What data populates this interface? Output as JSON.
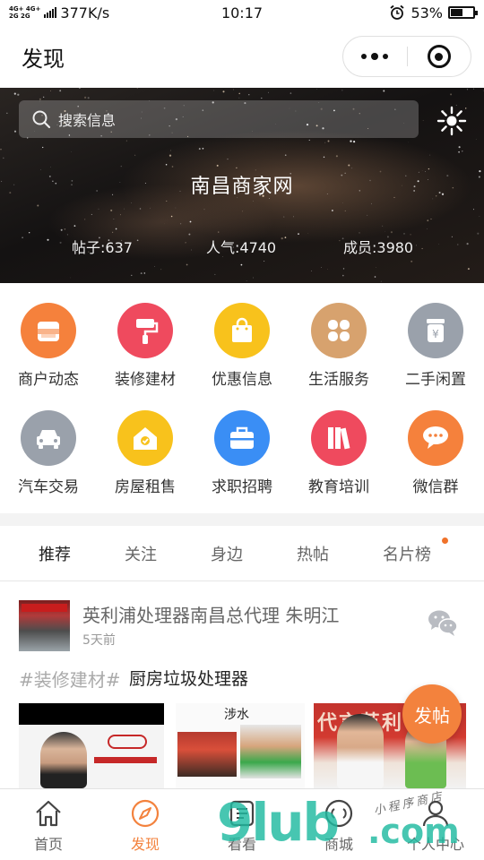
{
  "status_bar": {
    "network_top": "4G+ 4G+",
    "network_bottom": "2G 2G",
    "speed": "377K/s",
    "time": "10:17",
    "battery": "53%",
    "battery_level": 0.53,
    "icons": [
      "signal-icon",
      "alarm-icon",
      "battery-icon"
    ]
  },
  "nav": {
    "title": "发现",
    "capsule_icons": [
      "more-icon",
      "close-miniprogram-icon"
    ]
  },
  "banner": {
    "search_placeholder": "搜索信息",
    "site_name": "南昌商家网",
    "stats": [
      "帖子:637",
      "人气:4740",
      "成员:3980"
    ]
  },
  "categories": [
    {
      "label": "商户动态",
      "icon": "shop-icon",
      "color": "#f5813c"
    },
    {
      "label": "装修建材",
      "icon": "paint-roller-icon",
      "color": "#ef4a5e"
    },
    {
      "label": "优惠信息",
      "icon": "shopping-bag-icon",
      "color": "#f8c21c"
    },
    {
      "label": "生活服务",
      "icon": "clover-icon",
      "color": "#d7a26e"
    },
    {
      "label": "二手闲置",
      "icon": "yuan-jar-icon",
      "color": "#9aa1ab"
    },
    {
      "label": "汽车交易",
      "icon": "car-icon",
      "color": "#9aa1ab"
    },
    {
      "label": "房屋租售",
      "icon": "house-icon",
      "color": "#f8c21c"
    },
    {
      "label": "求职招聘",
      "icon": "briefcase-icon",
      "color": "#3a8ef5"
    },
    {
      "label": "教育培训",
      "icon": "books-icon",
      "color": "#ef4a5e"
    },
    {
      "label": "微信群",
      "icon": "chat-bubbles-icon",
      "color": "#f5813c"
    }
  ],
  "tabs": [
    "推荐",
    "关注",
    "身边",
    "热帖",
    "名片榜"
  ],
  "active_tab": "推荐",
  "post": {
    "title": "英利浦处理器南昌总代理 朱明江",
    "time": "5天前",
    "tag": "#装修建材#",
    "subject": "厨房垃圾处理器",
    "image2_label": "涉水",
    "image3_text": "代言英利"
  },
  "fab_label": "发帖",
  "tabbar": [
    {
      "label": "首页",
      "icon": "home-icon"
    },
    {
      "label": "发现",
      "icon": "compass-icon"
    },
    {
      "label": "看看",
      "icon": "list-icon"
    },
    {
      "label": "商城",
      "icon": "store-icon"
    },
    {
      "label": "个人中心",
      "icon": "user-icon"
    }
  ],
  "active_tabbar": "发现",
  "watermark": {
    "big": "9lub",
    "com": ".com",
    "small": "小程序商店"
  },
  "colors": {
    "accent": "#f3823d",
    "notification_dot": "#f0722a"
  }
}
